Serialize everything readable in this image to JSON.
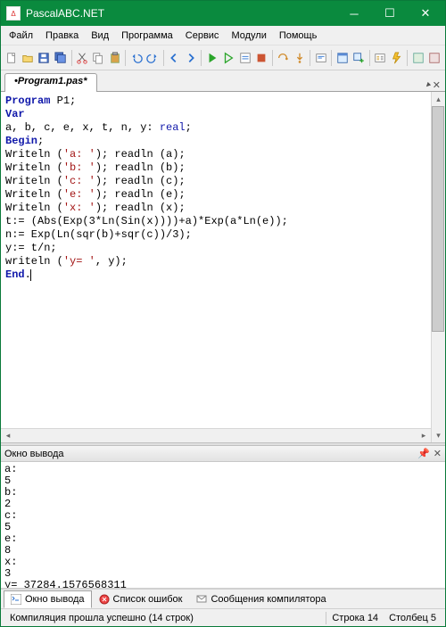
{
  "window": {
    "title": "PascalABC.NET"
  },
  "menu": {
    "file": "Файл",
    "edit": "Правка",
    "view": "Вид",
    "program": "Программа",
    "service": "Сервис",
    "modules": "Модули",
    "help": "Помощь"
  },
  "tabs": {
    "active": "•Program1.pas*"
  },
  "code": {
    "lines": [
      {
        "t": "kw",
        "s": "Program"
      },
      {
        "t": "p",
        "s": " P1;"
      },
      {
        "t": "nl"
      },
      {
        "t": "kw",
        "s": "Var"
      },
      {
        "t": "nl"
      },
      {
        "t": "p",
        "s": "a, b, c, e, x, t, n, y: "
      },
      {
        "t": "typ",
        "s": "real"
      },
      {
        "t": "p",
        "s": ";"
      },
      {
        "t": "nl"
      },
      {
        "t": "kw",
        "s": "Begin"
      },
      {
        "t": "p",
        "s": ";"
      },
      {
        "t": "nl"
      },
      {
        "t": "p",
        "s": "Writeln ("
      },
      {
        "t": "str",
        "s": "'a: '"
      },
      {
        "t": "p",
        "s": "); readln (a);"
      },
      {
        "t": "nl"
      },
      {
        "t": "p",
        "s": "Writeln ("
      },
      {
        "t": "str",
        "s": "'b: '"
      },
      {
        "t": "p",
        "s": "); readln (b);"
      },
      {
        "t": "nl"
      },
      {
        "t": "p",
        "s": "Writeln ("
      },
      {
        "t": "str",
        "s": "'c: '"
      },
      {
        "t": "p",
        "s": "); readln (c);"
      },
      {
        "t": "nl"
      },
      {
        "t": "p",
        "s": "Writeln ("
      },
      {
        "t": "str",
        "s": "'e: '"
      },
      {
        "t": "p",
        "s": "); readln (e);"
      },
      {
        "t": "nl"
      },
      {
        "t": "p",
        "s": "Writeln ("
      },
      {
        "t": "str",
        "s": "'x: '"
      },
      {
        "t": "p",
        "s": "); readln (x);"
      },
      {
        "t": "nl"
      },
      {
        "t": "p",
        "s": "t:= (Abs(Exp(3*Ln(Sin(x))))+a)*Exp(a*Ln(e));"
      },
      {
        "t": "nl"
      },
      {
        "t": "p",
        "s": "n:= Exp(Ln(sqr(b)+sqr(c))/3);"
      },
      {
        "t": "nl"
      },
      {
        "t": "p",
        "s": "y:= t/n;"
      },
      {
        "t": "nl"
      },
      {
        "t": "p",
        "s": "writeln ("
      },
      {
        "t": "str",
        "s": "'y= '"
      },
      {
        "t": "p",
        "s": ", y);"
      },
      {
        "t": "nl"
      },
      {
        "t": "kw",
        "s": "End"
      },
      {
        "t": "p",
        "s": "."
      },
      {
        "t": "cursor"
      }
    ]
  },
  "output_panel": {
    "title": "Окно вывода"
  },
  "output_text": "a:\n5\nb:\n2\nc:\n5\ne:\n8\nx:\n3\ny= 37284.1576568311\n",
  "bottom_tabs": {
    "output": "Окно вывода",
    "errors": "Список ошибок",
    "messages": "Сообщения компилятора"
  },
  "status": {
    "msg": "Компиляция прошла успешно (14 строк)",
    "line_lbl": "Строка",
    "line": "14",
    "col_lbl": "Столбец",
    "col": "5"
  },
  "icons": {
    "new": "new-file-icon",
    "open": "open-icon",
    "save": "save-icon",
    "saveall": "save-all-icon",
    "cut": "cut-icon",
    "copy": "copy-icon",
    "paste": "paste-icon",
    "undo": "undo-icon",
    "redo": "redo-icon",
    "back": "back-icon",
    "fwd": "forward-icon",
    "run": "run-icon",
    "runnobuild": "run-no-debug-icon",
    "compile": "compile-icon",
    "stop": "stop-icon",
    "stepover": "step-over-icon",
    "stepinto": "step-into-icon",
    "intellisense": "intellisense-icon",
    "designer": "designer-icon",
    "newform": "new-form-icon",
    "props": "properties-icon",
    "events": "events-icon",
    "ex1": "example1-icon",
    "ex2": "example2-icon"
  }
}
